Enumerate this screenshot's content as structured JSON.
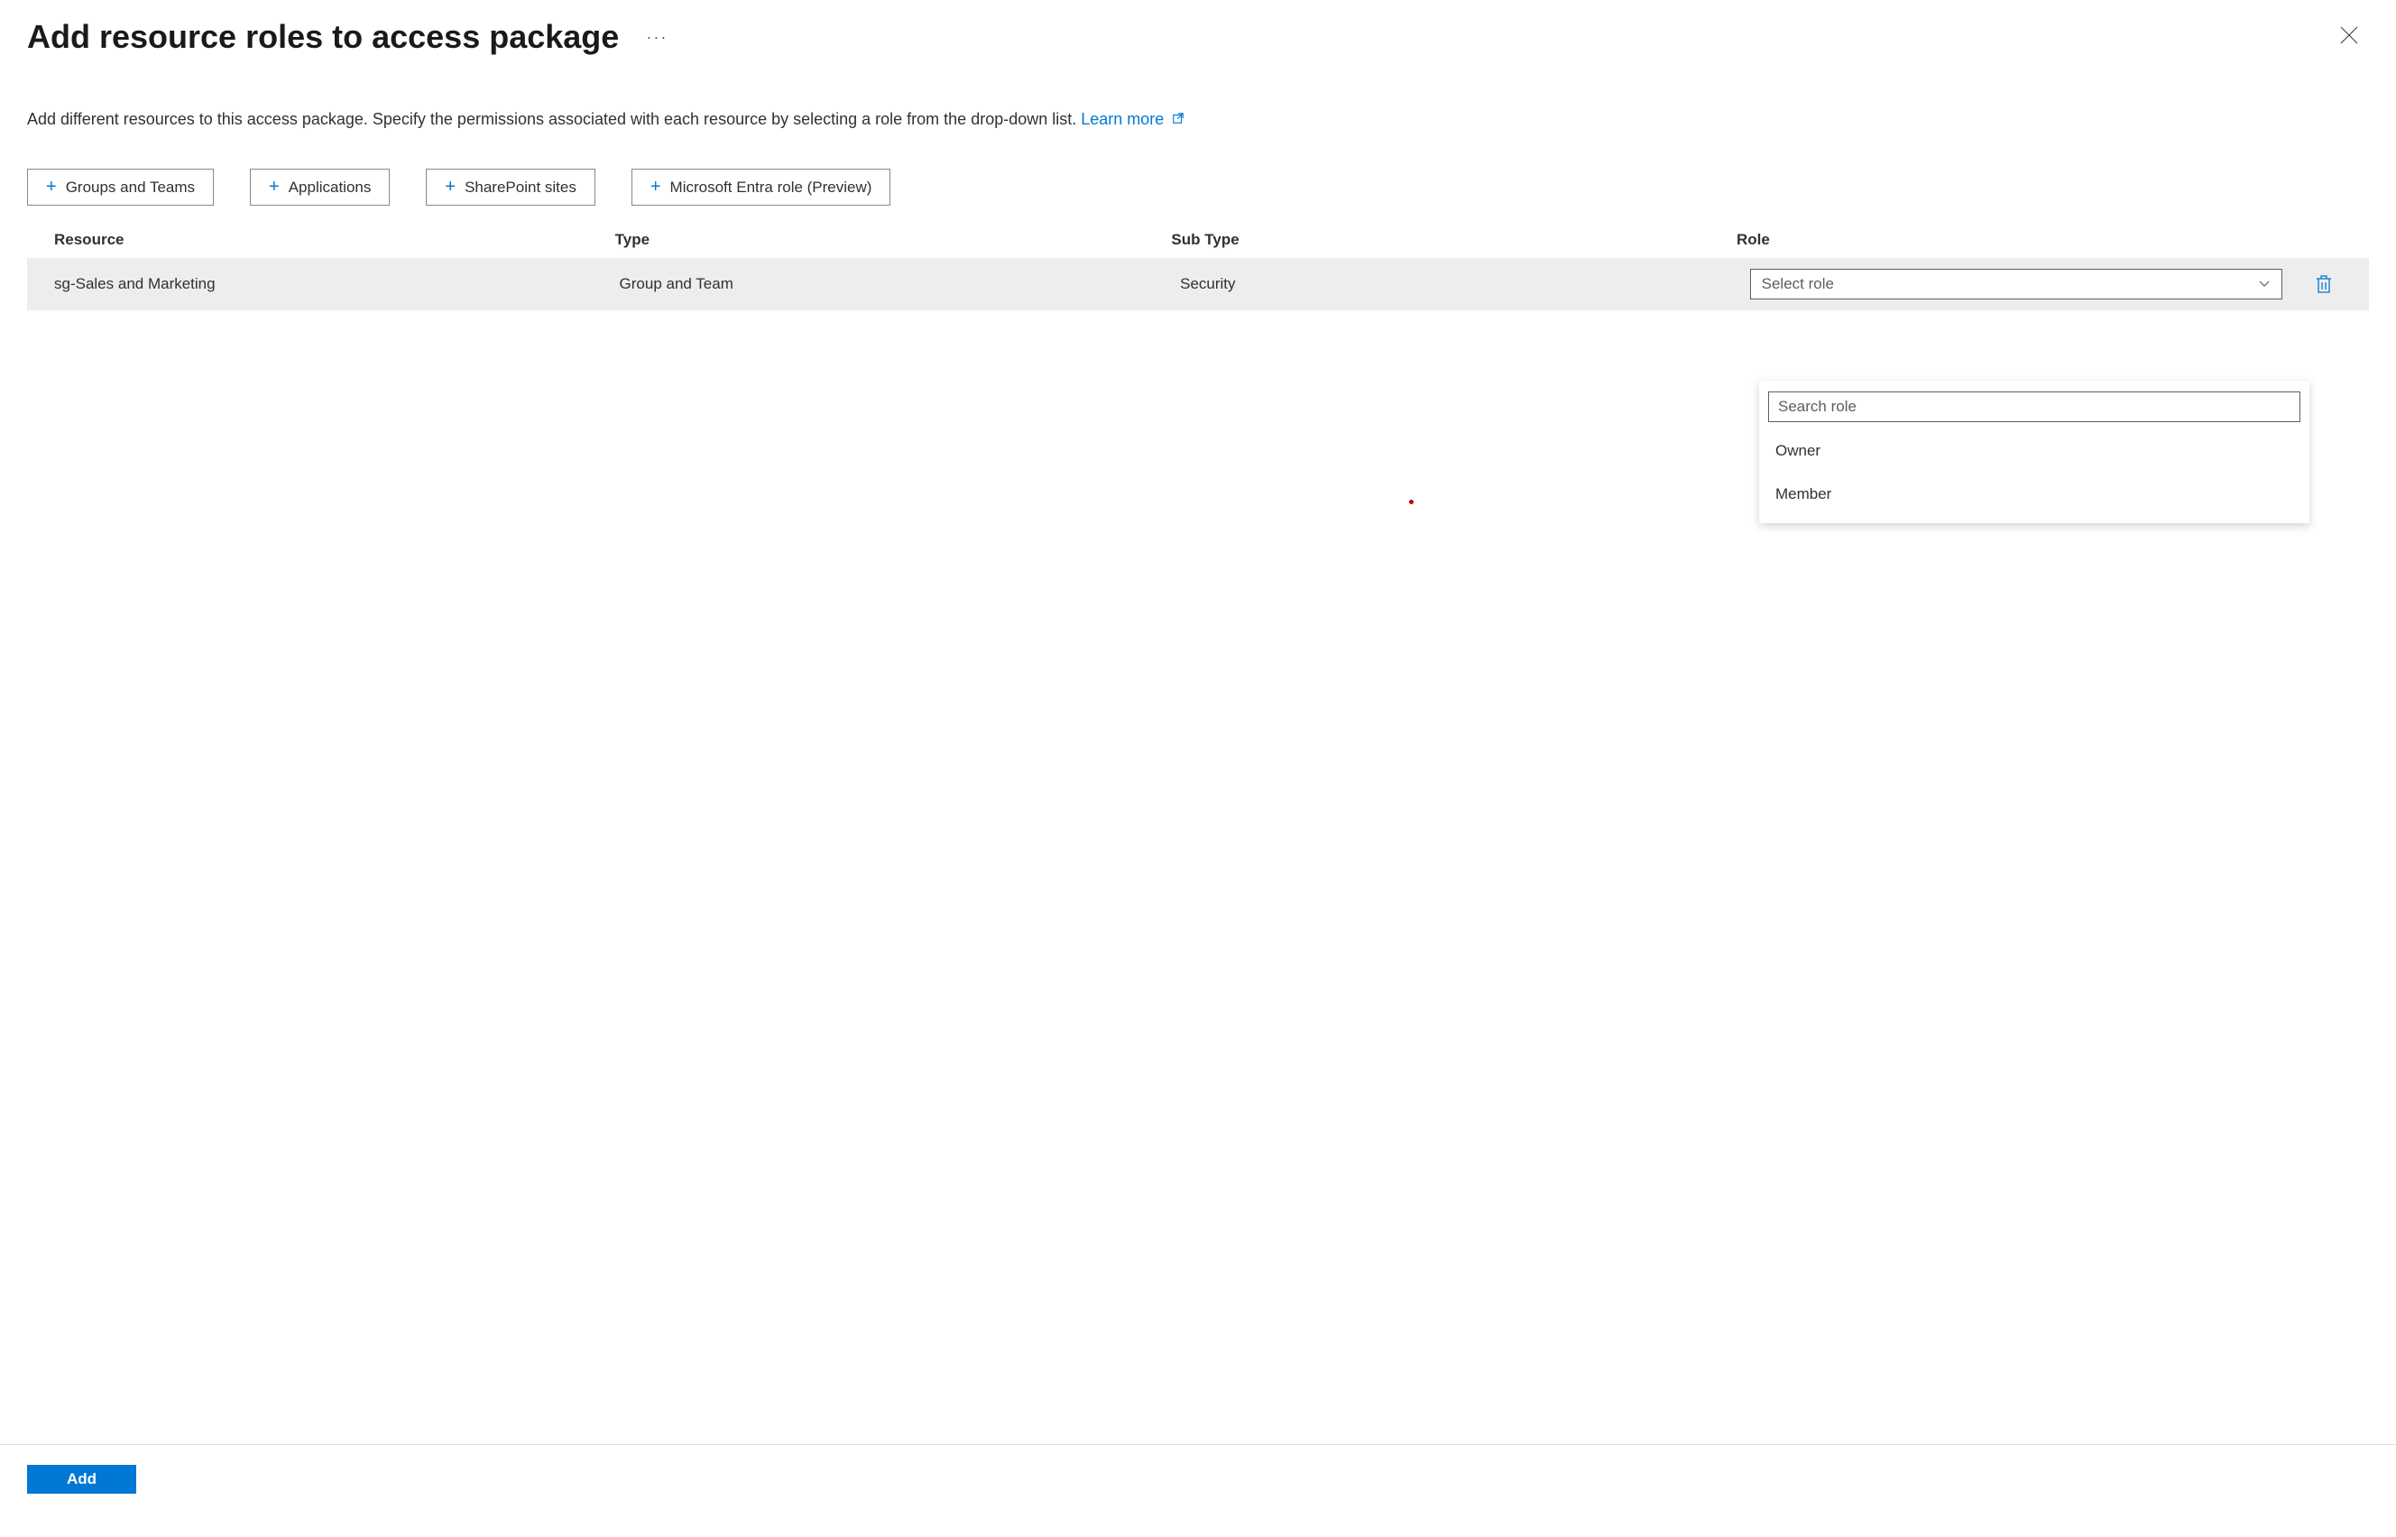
{
  "header": {
    "title": "Add resource roles to access package"
  },
  "description": {
    "text": "Add different resources to this access package. Specify the permissions associated with each resource by selecting a role from the drop-down list. ",
    "learn_more": "Learn more"
  },
  "buttons": {
    "groups_teams": "Groups and Teams",
    "applications": "Applications",
    "sharepoint": "SharePoint sites",
    "entra_role": "Microsoft Entra role (Preview)"
  },
  "table": {
    "headers": {
      "resource": "Resource",
      "type": "Type",
      "subtype": "Sub Type",
      "role": "Role"
    },
    "rows": [
      {
        "resource": "sg-Sales and Marketing",
        "type": "Group and Team",
        "subtype": "Security",
        "role_placeholder": "Select role"
      }
    ]
  },
  "role_dropdown": {
    "search_placeholder": "Search role",
    "options": [
      "Owner",
      "Member"
    ]
  },
  "footer": {
    "submit": "Add"
  }
}
